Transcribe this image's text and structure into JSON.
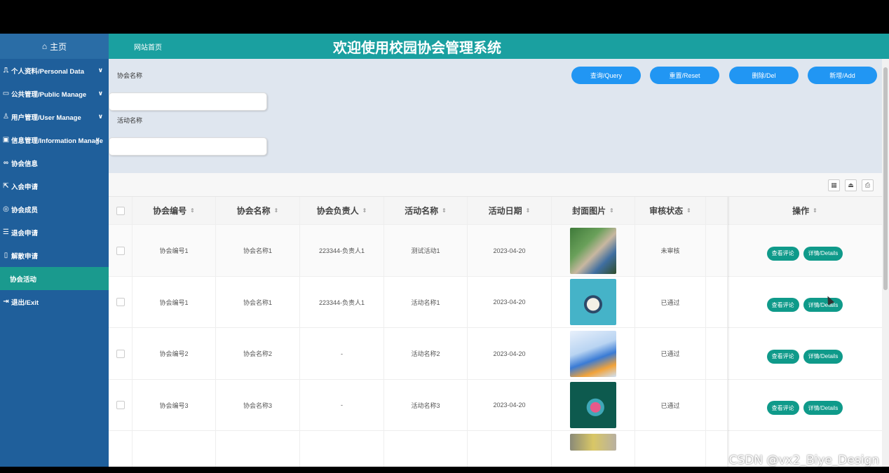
{
  "sidebar": {
    "home": "主页",
    "items": [
      {
        "label": "个人资料/Personal Data",
        "icon": "person-card-icon",
        "expandable": true
      },
      {
        "label": "公共管理/Public Manage",
        "icon": "monitor-icon",
        "expandable": true
      },
      {
        "label": "用户管理/User Manage",
        "icon": "user-icon",
        "expandable": true
      },
      {
        "label": "信息管理/Information Manage",
        "icon": "info-icon",
        "expandable": true
      },
      {
        "label": "协会信息",
        "icon": "link-icon",
        "expandable": false
      },
      {
        "label": "入会申请",
        "icon": "enter-icon",
        "expandable": false
      },
      {
        "label": "协会成员",
        "icon": "members-icon",
        "expandable": false
      },
      {
        "label": "退会申请",
        "icon": "exit-form-icon",
        "expandable": false
      },
      {
        "label": "解散申请",
        "icon": "dissolve-icon",
        "expandable": false
      },
      {
        "label": "协会活动",
        "icon": "",
        "expandable": false,
        "active": true
      },
      {
        "label": "退出/Exit",
        "icon": "logout-icon",
        "expandable": false
      }
    ]
  },
  "topbar": {
    "home_link": "网站首页",
    "title": "欢迎使用校园协会管理系统"
  },
  "search": {
    "field1_label": "协会名称",
    "field2_label": "活动名称",
    "query": "查询/Query",
    "reset": "重置/Reset",
    "delete": "删除/Del",
    "add": "新增/Add"
  },
  "table": {
    "columns": [
      "协会编号",
      "协会名称",
      "协会负责人",
      "活动名称",
      "活动日期",
      "封面图片",
      "审核状态",
      "",
      "操作"
    ],
    "rows": [
      {
        "id": "协会编号1",
        "name": "协会名称1",
        "leader": "223344-负责人1",
        "activity": "测试活动1",
        "date": "2023-04-20",
        "status": "未审核"
      },
      {
        "id": "协会编号1",
        "name": "协会名称1",
        "leader": "223344-负责人1",
        "activity": "活动名称1",
        "date": "2023-04-20",
        "status": "已通过"
      },
      {
        "id": "协会编号2",
        "name": "协会名称2",
        "leader": "-",
        "activity": "活动名称2",
        "date": "2023-04-20",
        "status": "已通过"
      },
      {
        "id": "协会编号3",
        "name": "协会名称3",
        "leader": "-",
        "activity": "活动名称3",
        "date": "2023-04-20",
        "status": "已通过"
      }
    ],
    "op_comment": "查看评论",
    "op_details": "详情/Details"
  },
  "watermark": "CSDN @vx2_Biye_Design",
  "colors": {
    "sidebar": "#1f5f9b",
    "topbar": "#1aa0a0",
    "active_item": "#1a9a8e",
    "primary_button": "#2196f3",
    "op_button": "#0f9a8a"
  }
}
